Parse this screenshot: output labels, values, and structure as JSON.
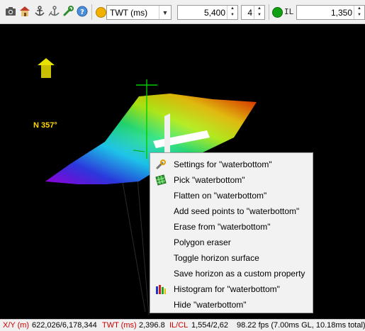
{
  "toolbar": {
    "icons": [
      "camera-icon",
      "home-icon",
      "anchor-icon",
      "anchor-alt-icon",
      "wrench-icon",
      "help-icon"
    ],
    "domain_dot_color": "#f2b100",
    "domain_select": "TWT (ms)",
    "depth_value": "5,400",
    "step_value": "4",
    "il_dot_color": "#11a011",
    "il_label": "IL",
    "il_value": "1,350"
  },
  "scene": {
    "north_label": "N 357°"
  },
  "context_menu": {
    "items": [
      {
        "label": "Settings for \"waterbottom\"",
        "icon": "wrench-icon"
      },
      {
        "label": "Pick \"waterbottom\"",
        "icon": "grid-pick-icon"
      },
      {
        "label": "Flatten on \"waterbottom\"",
        "icon": ""
      },
      {
        "label": "Add seed points to \"waterbottom\"",
        "icon": ""
      },
      {
        "label": "Erase from \"waterbottom\"",
        "icon": ""
      },
      {
        "label": "Polygon eraser",
        "icon": ""
      },
      {
        "label": "Toggle horizon surface",
        "icon": ""
      },
      {
        "label": "Save horizon as a custom property",
        "icon": ""
      },
      {
        "label": "Histogram for \"waterbottom\"",
        "icon": "histogram-icon"
      },
      {
        "label": "Hide \"waterbottom\"",
        "icon": ""
      }
    ]
  },
  "status_bar": {
    "xy_label": "X/Y (m)",
    "xy_value": "622,026/6,178,344",
    "twt_label": "TWT (ms)",
    "twt_value": "2,396.8",
    "ilcl_label": "IL/CL",
    "ilcl_value": "1,554/2,62",
    "fps": "98.22 fps (7.00ms GL, 10.18ms total)"
  }
}
